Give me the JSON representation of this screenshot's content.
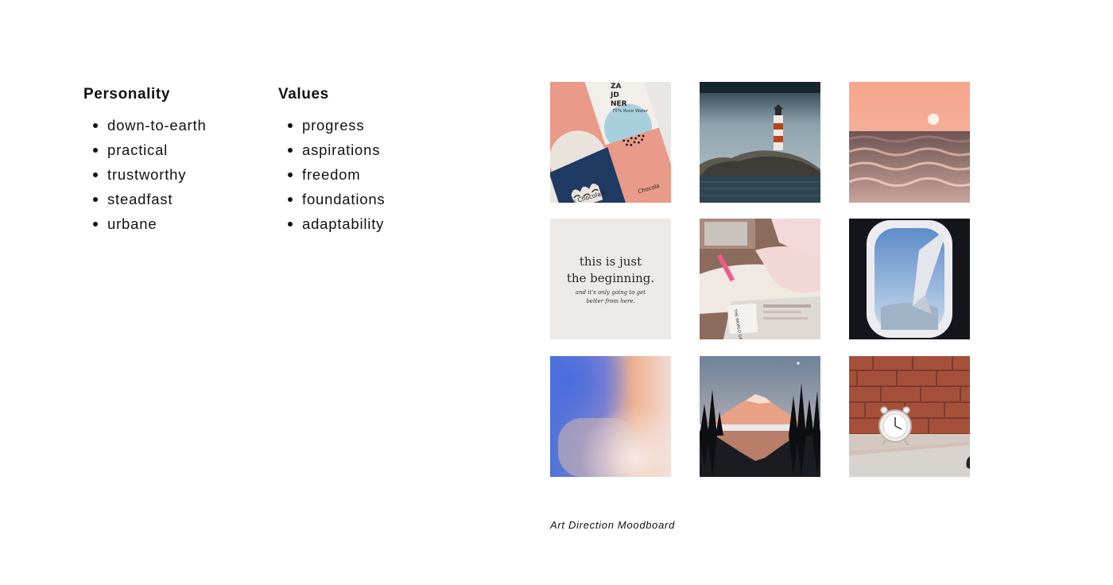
{
  "personality": {
    "heading": "Personality",
    "items": [
      "down-to-earth",
      "practical",
      "trustworthy",
      "steadfast",
      "urbane"
    ]
  },
  "values": {
    "heading": "Values",
    "items": [
      "progress",
      "aspirations",
      "freedom",
      "foundations",
      "adaptability"
    ]
  },
  "moodboard": {
    "caption": "Art Direction Moodboard",
    "chocolate": {
      "brand_line1": "ZA",
      "brand_line2": "JD",
      "brand_line3": "NER",
      "flavor": "75% Rose Water",
      "product": "Dark Chocolate",
      "product_short": "Chocola"
    },
    "quote": {
      "line1": "this is just",
      "line2": "the beginning.",
      "small1": "and it's only going to get",
      "small2": "better from here."
    },
    "newspaper_text": "THE WORLD GAZETTE",
    "colors": {
      "coral": "#e99a88",
      "navy": "#1f3a63",
      "sunset": "#f7a58c",
      "gradient_blue": "#4f73d8"
    }
  }
}
